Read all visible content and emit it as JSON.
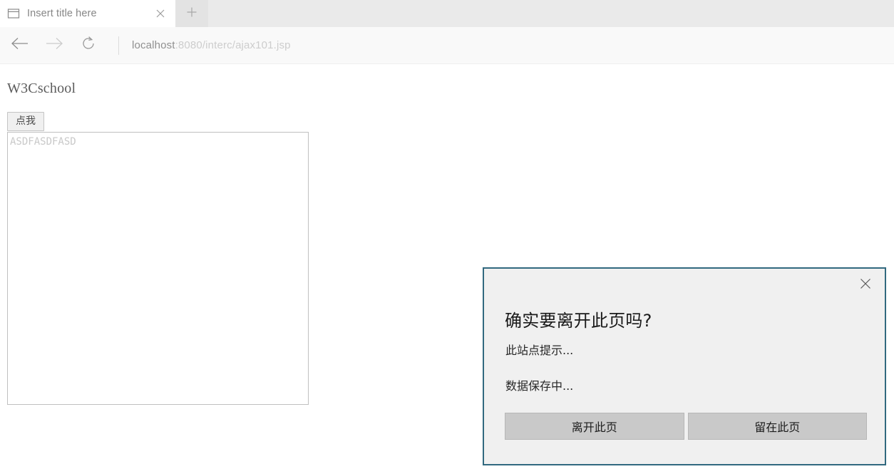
{
  "browser": {
    "tab": {
      "favicon": "window-icon",
      "title": "Insert title here",
      "close_icon": "close-icon"
    },
    "new_tab": {
      "icon": "plus-icon"
    },
    "toolbar": {
      "back_icon": "back-arrow-icon",
      "forward_icon": "forward-arrow-icon",
      "refresh_icon": "refresh-icon",
      "url_host": "localhost",
      "url_rest": ":8080/interc/ajax101.jsp"
    }
  },
  "page": {
    "heading": "W3Cschool",
    "button_label": "点我",
    "textarea_value": "ASDFASDFASD",
    "textarea_placeholder": ""
  },
  "dialog": {
    "title": "确实要离开此页吗?",
    "line1": "此站点提示...",
    "line2": "数据保存中...",
    "leave_button": "离开此页",
    "stay_button": "留在此页",
    "close_icon": "close-icon",
    "border_color": "#31697f",
    "background_color": "#f0f0f0",
    "button_color": "#c9c9c9"
  }
}
